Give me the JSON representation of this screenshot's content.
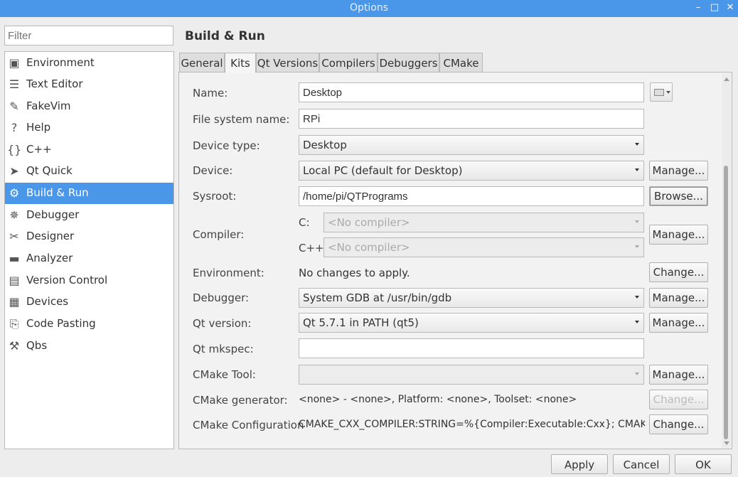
{
  "window": {
    "title": "Options",
    "min_glyph": "–",
    "max_glyph": "□",
    "close_glyph": "✕"
  },
  "filter": {
    "placeholder": "Filter"
  },
  "categories": [
    {
      "label": "Environment",
      "icon": "monitor-icon",
      "glyph": "▣"
    },
    {
      "label": "Text Editor",
      "icon": "text-editor-icon",
      "glyph": "☰"
    },
    {
      "label": "FakeVim",
      "icon": "fakevim-icon",
      "glyph": "✎"
    },
    {
      "label": "Help",
      "icon": "help-icon",
      "glyph": "?"
    },
    {
      "label": "C++",
      "icon": "cpp-braces-icon",
      "glyph": "{}"
    },
    {
      "label": "Qt Quick",
      "icon": "qt-quick-icon",
      "glyph": "➤"
    },
    {
      "label": "Build & Run",
      "icon": "build-run-icon",
      "glyph": "⚙"
    },
    {
      "label": "Debugger",
      "icon": "debugger-icon",
      "glyph": "✵"
    },
    {
      "label": "Designer",
      "icon": "designer-icon",
      "glyph": "✂"
    },
    {
      "label": "Analyzer",
      "icon": "analyzer-icon",
      "glyph": "▬"
    },
    {
      "label": "Version Control",
      "icon": "version-control-icon",
      "glyph": "▤"
    },
    {
      "label": "Devices",
      "icon": "devices-icon",
      "glyph": "▦"
    },
    {
      "label": "Code Pasting",
      "icon": "code-pasting-icon",
      "glyph": "⎘"
    },
    {
      "label": "Qbs",
      "icon": "hammer-icon",
      "glyph": "⚒"
    }
  ],
  "selected_category": "Build & Run",
  "page_title": "Build & Run",
  "tabs": [
    "General",
    "Kits",
    "Qt Versions",
    "Compilers",
    "Debuggers",
    "CMake"
  ],
  "active_tab": "Kits",
  "form": {
    "name": {
      "label": "Name:",
      "value": "Desktop"
    },
    "fs_name": {
      "label": "File system name:",
      "value": "RPi"
    },
    "device_type": {
      "label": "Device type:",
      "value": "Desktop"
    },
    "device": {
      "label": "Device:",
      "value": "Local PC (default for Desktop)",
      "button": "Manage..."
    },
    "sysroot": {
      "label": "Sysroot:",
      "value": "/home/pi/QTPrograms",
      "button": "Browse..."
    },
    "compiler": {
      "label": "Compiler:",
      "c_label": "C:",
      "c_value": "<No compiler>",
      "cxx_label": "C++:",
      "cxx_value": "<No compiler>",
      "button": "Manage..."
    },
    "environment": {
      "label": "Environment:",
      "value": "No changes to apply.",
      "button": "Change..."
    },
    "debugger": {
      "label": "Debugger:",
      "value": "System GDB at /usr/bin/gdb",
      "button": "Manage..."
    },
    "qt_version": {
      "label": "Qt version:",
      "value": "Qt 5.7.1 in PATH (qt5)",
      "button": "Manage..."
    },
    "qt_mkspec": {
      "label": "Qt mkspec:",
      "value": ""
    },
    "cmake_tool": {
      "label": "CMake Tool:",
      "value": "",
      "button": "Manage..."
    },
    "cmake_generator": {
      "label": "CMake generator:",
      "value": "<none> - <none>, Platform: <none>, Toolset: <none>",
      "button": "Change..."
    },
    "cmake_config": {
      "label": "CMake Configuration",
      "value": "CMAKE_CXX_COMPILER:STRING=%{Compiler:Executable:Cxx}; CMAKE...",
      "button": "Change..."
    }
  },
  "dialog_buttons": {
    "apply": "Apply",
    "cancel": "Cancel",
    "ok": "OK"
  },
  "colors": {
    "titlebar": "#4a96e8",
    "selection": "#4a96e8"
  }
}
